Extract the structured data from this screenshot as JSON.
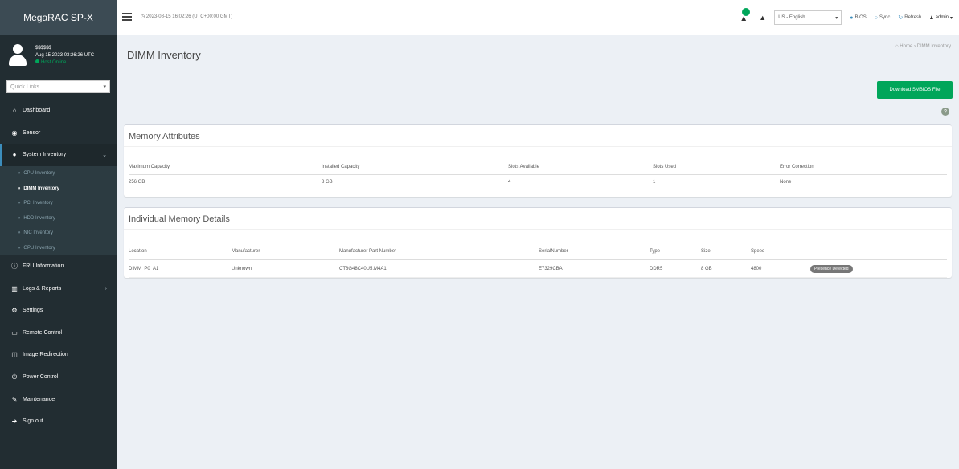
{
  "app": {
    "brand": "MegaRAC SP-X"
  },
  "user": {
    "name": "$$$$$$",
    "last_login": "Aug 15 2023 03:26:26 UTC",
    "status": "Host Online"
  },
  "sidebar": {
    "quick_links_placeholder": "Quick Links...",
    "items": [
      {
        "label": "Dashboard",
        "icon": "dashboard-icon"
      },
      {
        "label": "Sensor",
        "icon": "sensor-icon"
      },
      {
        "label": "System Inventory",
        "icon": "inventory-icon"
      },
      {
        "label": "FRU Information",
        "icon": "info-icon"
      },
      {
        "label": "Logs & Reports",
        "icon": "chart-icon"
      },
      {
        "label": "Settings",
        "icon": "gear-icon"
      },
      {
        "label": "Remote Control",
        "icon": "monitor-icon"
      },
      {
        "label": "Image Redirection",
        "icon": "image-icon"
      },
      {
        "label": "Power Control",
        "icon": "power-icon"
      },
      {
        "label": "Maintenance",
        "icon": "wrench-icon"
      },
      {
        "label": "Sign out",
        "icon": "signout-icon"
      }
    ],
    "system_inventory_sub": [
      {
        "label": "CPU Inventory",
        "active": false
      },
      {
        "label": "DIMM Inventory",
        "active": true
      },
      {
        "label": "PCI Inventory",
        "active": false
      },
      {
        "label": "HDD Inventory",
        "active": false
      },
      {
        "label": "NIC Inventory",
        "active": false
      },
      {
        "label": "GPU Inventory",
        "active": false
      }
    ]
  },
  "topbar": {
    "datetime": "2023-08-15 16:02:26 (UTC+00:00 GMT)",
    "language": "US - English",
    "bios": "BIOS",
    "sync": "Sync",
    "refresh": "Refresh",
    "admin": "admin"
  },
  "main": {
    "title": "DIMM Inventory",
    "breadcrumb_home": "Home",
    "breadcrumb_current": "DIMM Inventory",
    "download_button": "Download SMBIOS File",
    "memory_attributes": {
      "title": "Memory Attributes",
      "headers": [
        "Maximum Capacity",
        "Installed Capacity",
        "Slots Available",
        "Slots Used",
        "Error Correction"
      ],
      "values": [
        "256 GB",
        "8 GB",
        "4",
        "1",
        "None"
      ]
    },
    "memory_details": {
      "title": "Individual Memory Details",
      "headers": [
        "Location",
        "Manufacturer",
        "Manufacturer Part Number",
        "SerialNumber",
        "Type",
        "Size",
        "Speed"
      ],
      "row": {
        "location": "DIMM_P0_A1",
        "manufacturer": "Unknown",
        "part_number": "CT8G48C40U5.M4A1",
        "serial": "E7329CBA",
        "type": "DDR5",
        "size": "8 GB",
        "speed": "4800",
        "status": "Presence Detected"
      }
    }
  },
  "colors": {
    "sidebar_bg": "#222d32",
    "accent": "#3c8dbc",
    "success": "#00a65a"
  }
}
